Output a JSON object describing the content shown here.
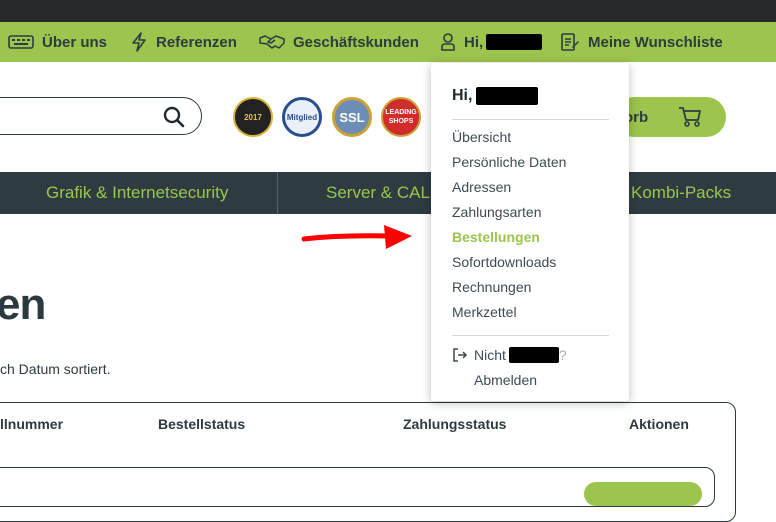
{
  "topbar": {
    "items": [
      {
        "label": "Über uns",
        "icon": "keyboard-icon"
      },
      {
        "label": "Referenzen",
        "icon": "lightning-icon"
      },
      {
        "label": "Geschäftskunden",
        "icon": "handshake-icon"
      },
      {
        "label": "Hi,",
        "icon": "user-icon"
      },
      {
        "label": "Meine Wunschliste",
        "icon": "wishlist-icon"
      }
    ]
  },
  "badges": [
    "2017",
    "Mitglied",
    "SSL",
    "LEADING SHOPS"
  ],
  "cart": {
    "label": "orb",
    "icon": "cart-icon"
  },
  "nav": {
    "items": [
      "Grafik & Internetsecurity",
      "Server & CAL",
      "Kombi-Packs"
    ]
  },
  "page": {
    "heading": "en",
    "subtitle": "ch Datum sortiert."
  },
  "table": {
    "headers": [
      "llnummer",
      "Bestellstatus",
      "Zahlungsstatus",
      "Aktionen"
    ]
  },
  "dropdown": {
    "greeting": "Hi,",
    "menu": [
      "Übersicht",
      "Persönliche Daten",
      "Adressen",
      "Zahlungsarten",
      "Bestellungen",
      "Sofortdownloads",
      "Rechnungen",
      "Merkzettel"
    ],
    "active_item": "Bestellungen",
    "logout_prefix": "Nicht",
    "logout_suffix": "?",
    "logout_label": "Abmelden"
  },
  "colors": {
    "accent": "#9bc54d",
    "nav_bg": "#2e3c41",
    "annotation_arrow": "#ff0000"
  }
}
